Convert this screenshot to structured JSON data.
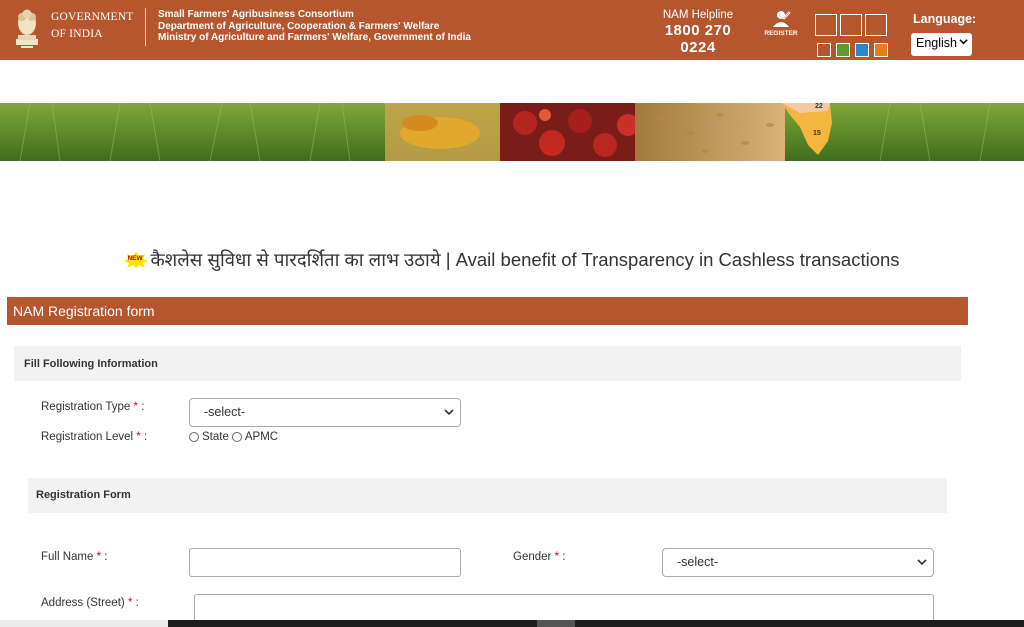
{
  "header": {
    "gov_line1": "GOVERNMENT",
    "gov_line2": "OF INDIA",
    "ministry_line1": "Small Farmers' Agribusiness Consortium",
    "ministry_line2": "Department of Agriculture, Cooperation & Farmers' Welfare",
    "ministry_line3": "Ministry of Agriculture and Farmers' Welfare, Government of India",
    "helpline_label": "NAM Helpline",
    "helpline_number": "1800 270 0224",
    "register_label": "REGISTER",
    "language_label": "Language:",
    "language_selected": "English",
    "brand_color": "#b5562f",
    "theme_swatches": [
      "#ffffff",
      "#5e9a2e",
      "#2e86c9",
      "#e87b1c"
    ]
  },
  "banner": {
    "map_label_1": "22",
    "map_label_2": "15"
  },
  "tagline": {
    "badge": "NEW",
    "text": "कैशलेस सुविधा से पारदर्शिता का लाभ उठाये | Avail benefit of Transparency in Cashless transactions"
  },
  "form": {
    "title": "NAM Registration form",
    "section_info": "Fill Following Information",
    "registration_type_label": "Registration Type",
    "registration_type_value": "-select-",
    "registration_level_label": "Registration Level",
    "level_options": [
      "State",
      "APMC"
    ],
    "section_form": "Registration Form",
    "full_name_label": "Full Name",
    "gender_label": "Gender",
    "gender_value": "-select-",
    "address_label": "Address (Street)",
    "required_mark": "*",
    "colon": ":"
  }
}
